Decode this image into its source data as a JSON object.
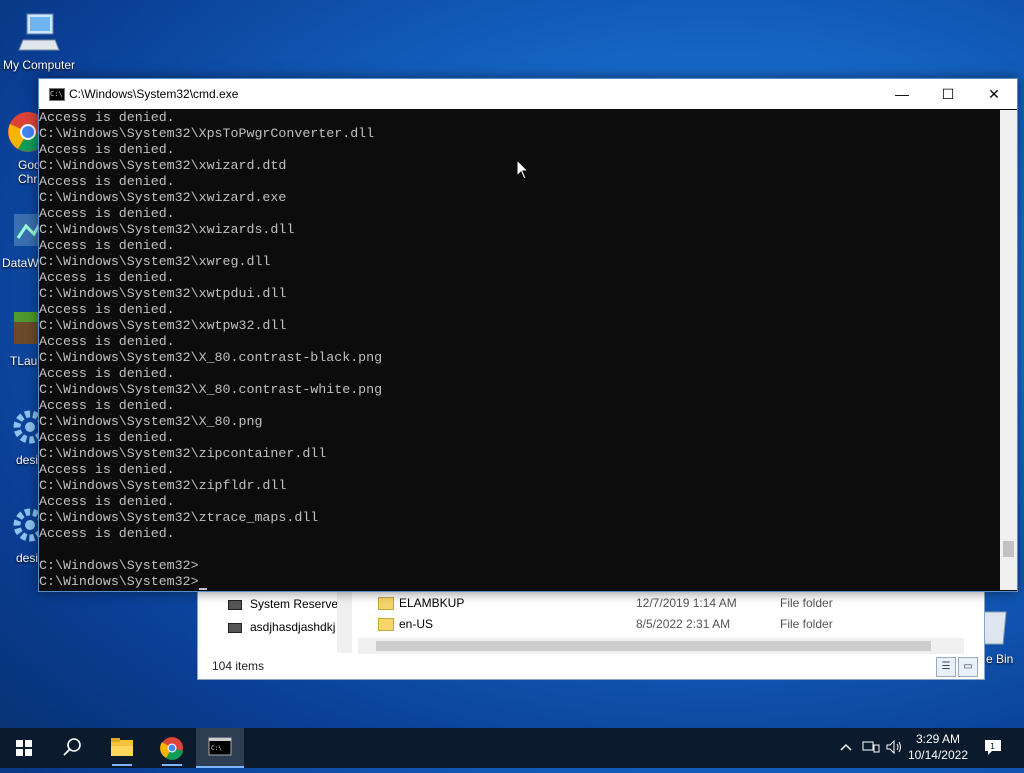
{
  "desktop": {
    "icons": [
      {
        "label": "My Computer",
        "icon": "computer-icon"
      },
      {
        "label": "Goo\nChr",
        "icon": "chrome-icon"
      },
      {
        "label": "DataW",
        "icon": "app-icon"
      },
      {
        "label": "TLau",
        "icon": "minecraft-icon"
      },
      {
        "label": "desi",
        "icon": "gear-icon"
      },
      {
        "label": "desi",
        "icon": "gear-icon"
      },
      {
        "label": "e Bin",
        "icon": "recycle-bin-icon"
      }
    ]
  },
  "cmd": {
    "title": "C:\\Windows\\System32\\cmd.exe",
    "lines": [
      "Access is denied.",
      "C:\\Windows\\System32\\XpsToPwgrConverter.dll",
      "Access is denied.",
      "C:\\Windows\\System32\\xwizard.dtd",
      "Access is denied.",
      "C:\\Windows\\System32\\xwizard.exe",
      "Access is denied.",
      "C:\\Windows\\System32\\xwizards.dll",
      "Access is denied.",
      "C:\\Windows\\System32\\xwreg.dll",
      "Access is denied.",
      "C:\\Windows\\System32\\xwtpdui.dll",
      "Access is denied.",
      "C:\\Windows\\System32\\xwtpw32.dll",
      "Access is denied.",
      "C:\\Windows\\System32\\X_80.contrast-black.png",
      "Access is denied.",
      "C:\\Windows\\System32\\X_80.contrast-white.png",
      "Access is denied.",
      "C:\\Windows\\System32\\X_80.png",
      "Access is denied.",
      "C:\\Windows\\System32\\zipcontainer.dll",
      "Access is denied.",
      "C:\\Windows\\System32\\zipfldr.dll",
      "Access is denied.",
      "C:\\Windows\\System32\\ztrace_maps.dll",
      "Access is denied.",
      "",
      "C:\\Windows\\System32>",
      "C:\\Windows\\System32>"
    ],
    "minimize": "—",
    "maximize": "☐",
    "close": "✕"
  },
  "explorer": {
    "nav": [
      "System Reserved",
      "asdjhasdjashdkj"
    ],
    "files": [
      {
        "name": "ELAMBKUP",
        "date": "12/7/2019 1:14 AM",
        "type": "File folder"
      },
      {
        "name": "en-US",
        "date": "8/5/2022 2:31 AM",
        "type": "File folder"
      }
    ],
    "status": "104 items"
  },
  "taskbar": {
    "time": "3:29 AM",
    "date": "10/14/2022",
    "items": [
      "start-icon",
      "search-icon",
      "file-explorer-icon",
      "chrome-icon",
      "cmd-icon"
    ]
  }
}
